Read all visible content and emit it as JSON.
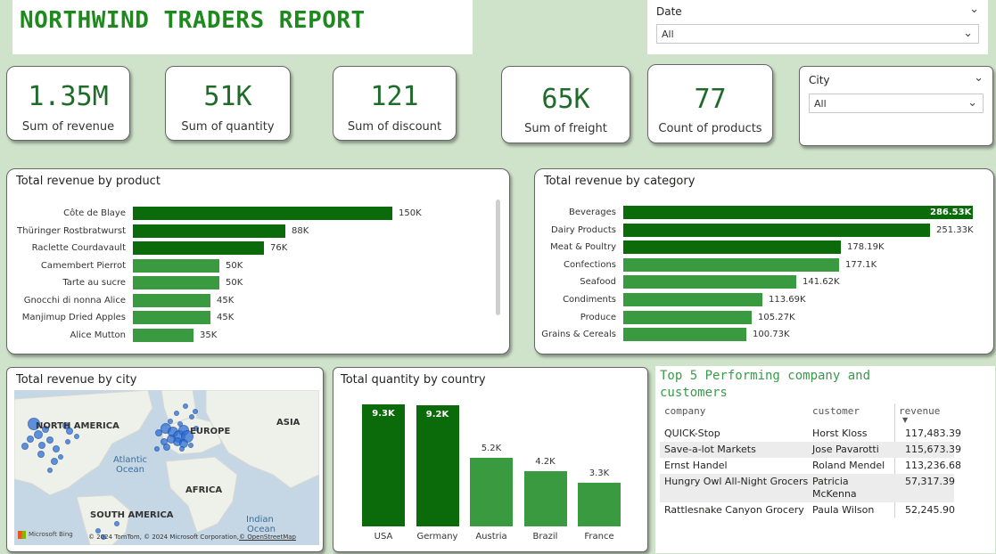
{
  "title": "NORTHWIND TRADERS REPORT",
  "slicers": {
    "date": {
      "label": "Date",
      "value": "All"
    },
    "city": {
      "label": "City",
      "value": "All"
    }
  },
  "kpis": [
    {
      "value": "1.35M",
      "label": "Sum of revenue"
    },
    {
      "value": "51K",
      "label": "Sum of quantity"
    },
    {
      "value": "121",
      "label": "Sum of discount"
    },
    {
      "value": "65K",
      "label": "Sum of freight"
    },
    {
      "value": "77",
      "label": "Count of products"
    }
  ],
  "colors": {
    "dark_green": "#0b6b0b",
    "light_green": "#3a9a3f",
    "background": "#cfe3ca",
    "title_green": "#1e8a1e"
  },
  "chart_data": [
    {
      "type": "bar",
      "orientation": "horizontal",
      "title": "Total revenue by product",
      "categories": [
        "Côte de Blaye",
        "Thüringer Rostbratwurst",
        "Raclette Courdavault",
        "Camembert Pierrot",
        "Tarte au sucre",
        "Gnocchi di nonna Alice",
        "Manjimup Dried Apples",
        "Alice Mutton"
      ],
      "values": [
        150000,
        88000,
        76000,
        50000,
        50000,
        45000,
        45000,
        35000
      ],
      "data_labels": [
        "150K",
        "88K",
        "76K",
        "50K",
        "50K",
        "45K",
        "45K",
        "35K"
      ],
      "bar_shades": [
        "dark",
        "dark",
        "dark",
        "light",
        "light",
        "light",
        "light",
        "light"
      ],
      "xlim": [
        0,
        160000
      ]
    },
    {
      "type": "bar",
      "orientation": "horizontal",
      "title": "Total revenue by category",
      "categories": [
        "Beverages",
        "Dairy Products",
        "Meat & Poultry",
        "Confections",
        "Seafood",
        "Condiments",
        "Produce",
        "Grains & Cereals"
      ],
      "values": [
        286530,
        251330,
        178190,
        177100,
        141620,
        113690,
        105270,
        100730
      ],
      "data_labels": [
        "286.53K",
        "251.33K",
        "178.19K",
        "177.1K",
        "141.62K",
        "113.69K",
        "105.27K",
        "100.73K"
      ],
      "bar_shades": [
        "dark",
        "dark",
        "dark",
        "light",
        "light",
        "light",
        "light",
        "light"
      ],
      "xlim": [
        0,
        286530
      ]
    },
    {
      "type": "bar",
      "orientation": "vertical",
      "title": "Total quantity by country",
      "categories": [
        "USA",
        "Germany",
        "Austria",
        "Brazil",
        "France"
      ],
      "values": [
        9300,
        9200,
        5200,
        4200,
        3300
      ],
      "data_labels": [
        "9.3K",
        "9.2K",
        "5.2K",
        "4.2K",
        "3.3K"
      ],
      "bar_shades": [
        "dark",
        "dark",
        "light",
        "light",
        "light"
      ],
      "ylim": [
        0,
        9300
      ]
    }
  ],
  "map": {
    "title": "Total revenue by city",
    "labels": {
      "north_america": "NORTH AMERICA",
      "europe": "EUROPE",
      "asia": "ASIA",
      "atlantic": "Atlantic",
      "ocean": "Ocean",
      "africa": "AFRICA",
      "south_america": "SOUTH AMERICA",
      "indian": "Indian",
      "indian_ocean": "Ocean"
    },
    "logo": "Microsoft Bing",
    "attribution": "© 2024 TomTom, © 2024 Microsoft Corporation,",
    "osm": "© OpenStreetMap"
  },
  "table": {
    "title": "Top 5 Performing company and customers",
    "headers": [
      "company",
      "customer",
      "revenue"
    ],
    "rows": [
      {
        "company": "QUICK-Stop",
        "customer": "Horst Kloss",
        "revenue": "117,483.39"
      },
      {
        "company": "Save-a-lot Markets",
        "customer": "Jose Pavarotti",
        "revenue": "115,673.39"
      },
      {
        "company": "Ernst Handel",
        "customer": "Roland Mendel",
        "revenue": "113,236.68"
      },
      {
        "company": "Hungry Owl All-Night Grocers",
        "customer": "Patricia McKenna",
        "revenue": "57,317.39"
      },
      {
        "company": "Rattlesnake Canyon Grocery",
        "customer": "Paula Wilson",
        "revenue": "52,245.90"
      }
    ]
  }
}
